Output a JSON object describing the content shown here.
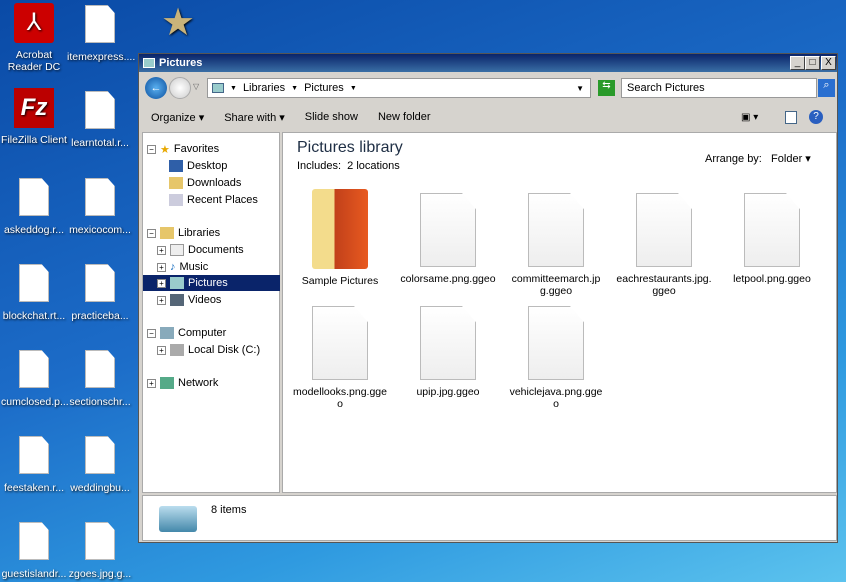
{
  "desktop": {
    "icons": [
      {
        "label": "Acrobat Reader DC",
        "type": "acrobat"
      },
      {
        "label": "itemexpress....",
        "type": "doc"
      },
      {
        "label": "FileZilla Client",
        "type": "filezilla"
      },
      {
        "label": "learntotal.r...",
        "type": "doc"
      },
      {
        "label": "askeddog.r...",
        "type": "doc"
      },
      {
        "label": "mexicocom...",
        "type": "doc"
      },
      {
        "label": "blockchat.rt...",
        "type": "doc"
      },
      {
        "label": "practiceba...",
        "type": "doc"
      },
      {
        "label": "cumclosed.p...",
        "type": "doc"
      },
      {
        "label": "sectionschr...",
        "type": "doc"
      },
      {
        "label": "feestaken.r...",
        "type": "doc"
      },
      {
        "label": "weddingbu...",
        "type": "doc"
      },
      {
        "label": "guestislandr...",
        "type": "doc"
      },
      {
        "label": "zgoes.jpg.g...",
        "type": "doc"
      }
    ]
  },
  "window": {
    "title": "Pictures",
    "minimize": "_",
    "maximize": "□",
    "close": "X"
  },
  "address": {
    "crumbs": [
      "Libraries",
      "Pictures"
    ]
  },
  "search": {
    "placeholder": "Search Pictures"
  },
  "toolbar": {
    "organize": "Organize",
    "share": "Share with",
    "slideshow": "Slide show",
    "newfolder": "New folder"
  },
  "nav": {
    "favorites": "Favorites",
    "desktop": "Desktop",
    "downloads": "Downloads",
    "recent": "Recent Places",
    "libraries": "Libraries",
    "documents": "Documents",
    "music": "Music",
    "pictures": "Pictures",
    "videos": "Videos",
    "computer": "Computer",
    "localdisk": "Local Disk (C:)",
    "network": "Network"
  },
  "content": {
    "title": "Pictures library",
    "includes": "Includes:",
    "locations": "2 locations",
    "arrange_label": "Arrange by:",
    "arrange_value": "Folder",
    "files": [
      "Sample Pictures",
      "colorsame.png.ggeo",
      "committeemarch.jpg.ggeo",
      "eachrestaurants.jpg.ggeo",
      "letpool.png.ggeo",
      "modellooks.png.ggeo",
      "upip.jpg.ggeo",
      "vehiclejava.png.ggeo"
    ]
  },
  "status": {
    "count": "8 items"
  },
  "colors": {
    "selection": "#0a246a",
    "titlebar": "#0a246a"
  }
}
